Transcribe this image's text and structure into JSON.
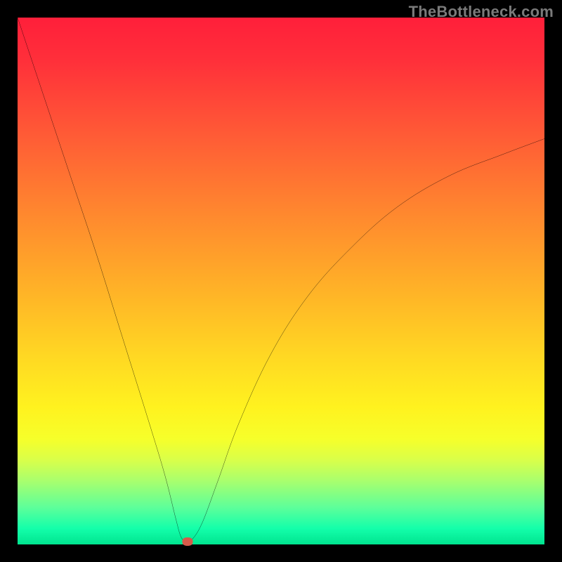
{
  "watermark": "TheBottleneck.com",
  "colors": {
    "frame": "#000000",
    "curve": "#000000",
    "marker": "#d65a4a",
    "gradient_top": "#ff1f3a",
    "gradient_bottom": "#00e48f"
  },
  "chart_data": {
    "type": "line",
    "title": "",
    "xlabel": "",
    "ylabel": "",
    "xlim": [
      0,
      100
    ],
    "ylim": [
      0,
      100
    ],
    "grid": false,
    "series": [
      {
        "name": "bottleneck-curve",
        "x": [
          0,
          5,
          10,
          15,
          20,
          25,
          28,
          30,
          31,
          32,
          33,
          35,
          38,
          42,
          48,
          55,
          63,
          72,
          82,
          92,
          100
        ],
        "y": [
          100,
          85,
          70,
          55,
          39,
          23,
          13,
          5,
          1.5,
          0.5,
          0.8,
          4,
          12,
          23,
          36,
          47,
          56,
          64,
          70,
          74,
          77
        ]
      }
    ],
    "annotations": [
      {
        "name": "marker",
        "x": 32.2,
        "y": 0.6
      }
    ]
  }
}
